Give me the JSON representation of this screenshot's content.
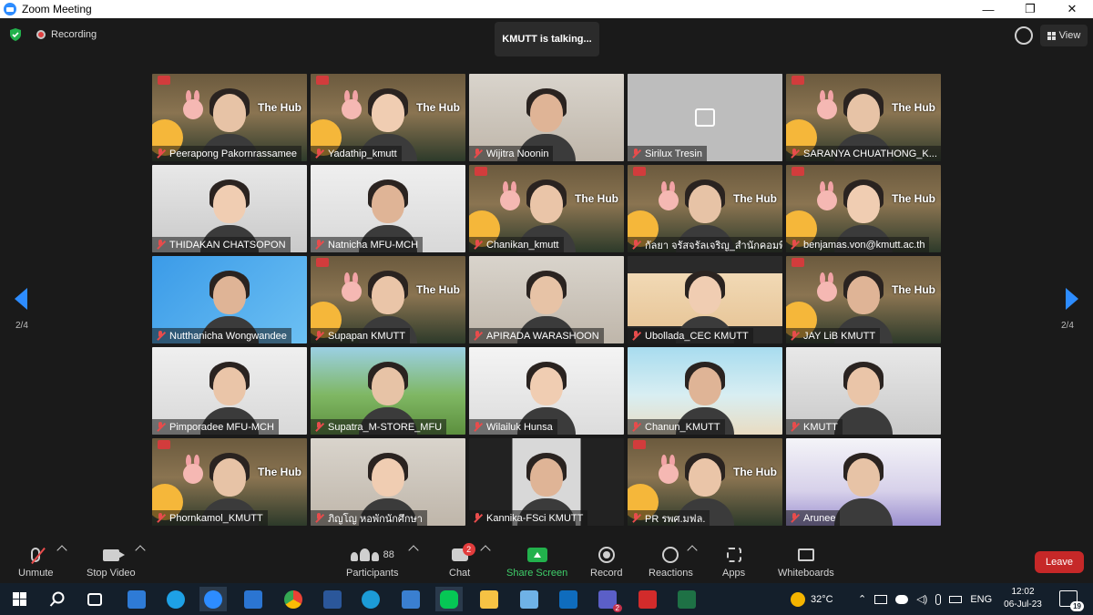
{
  "window": {
    "title": "Zoom Meeting",
    "minimize": "—",
    "maximize": "❐",
    "close": "✕"
  },
  "top": {
    "recording_label": "Recording",
    "talking": "KMUTT is talking...",
    "view_label": "View"
  },
  "pagination": {
    "left": "2/4",
    "right": "2/4"
  },
  "participants_grid": [
    {
      "name": "Peerapong Pakornrassamee",
      "bg": "hub"
    },
    {
      "name": "Yadathip_kmutt",
      "bg": "hub"
    },
    {
      "name": "Wijitra Noonin",
      "bg": "room"
    },
    {
      "name": "Sirilux Tresin",
      "bg": "gray"
    },
    {
      "name": "SARANYA CHUATHONG_K...",
      "bg": "hub"
    },
    {
      "name": "THIDAKAN CHATSOPON",
      "bg": "office"
    },
    {
      "name": "Natnicha MFU-MCH",
      "bg": "plain"
    },
    {
      "name": "Chanikan_kmutt",
      "bg": "hub"
    },
    {
      "name": "กัลยา จรัสจรัลเจริญ_สำนักคอมพิว...",
      "bg": "hub"
    },
    {
      "name": "benjamas.von@kmutt.ac.th",
      "bg": "hub"
    },
    {
      "name": "Nutthanicha Wongwandee",
      "bg": "blue"
    },
    {
      "name": "Supapan KMUTT",
      "bg": "hub"
    },
    {
      "name": "APIRADA WARASHOON",
      "bg": "room"
    },
    {
      "name": "Ubollada_CEC KMUTT",
      "bg": "colly"
    },
    {
      "name": "JAY LiB KMUTT",
      "bg": "hub"
    },
    {
      "name": "Pimporadee MFU-MCH",
      "bg": "plain"
    },
    {
      "name": "Supatra_M-STORE_MFU",
      "bg": "integrity"
    },
    {
      "name": "Wilailuk Hunsa",
      "bg": "chart"
    },
    {
      "name": "Chanun_KMUTT",
      "bg": "beach"
    },
    {
      "name": "KMUTT",
      "bg": "office"
    },
    {
      "name": "Phornkamol_KMUTT",
      "bg": "hub"
    },
    {
      "name": "ภิญโญ หอพักนักศึกษา",
      "bg": "room"
    },
    {
      "name": "Kannika-FSci KMUTT",
      "bg": "dark"
    },
    {
      "name": "PR รพศ.มฟล.",
      "bg": "hub"
    },
    {
      "name": "Arunee",
      "bg": "direktion"
    }
  ],
  "hub_text": "The Hub",
  "toolbar": {
    "unmute": "Unmute",
    "stop_video": "Stop Video",
    "participants": "Participants",
    "participants_count": "88",
    "chat": "Chat",
    "chat_badge": "2",
    "share_screen": "Share Screen",
    "record": "Record",
    "reactions": "Reactions",
    "apps": "Apps",
    "whiteboards": "Whiteboards",
    "leave": "Leave"
  },
  "taskbar": {
    "weather": "32°C",
    "language": "ENG",
    "time": "12:02",
    "date": "06-Jul-23",
    "notifications": "19",
    "teams_badge": "2"
  },
  "colors": {
    "accent": "#2d8cff",
    "leave": "#c62828",
    "share": "#22b14c",
    "badge": "#e23c3c"
  }
}
